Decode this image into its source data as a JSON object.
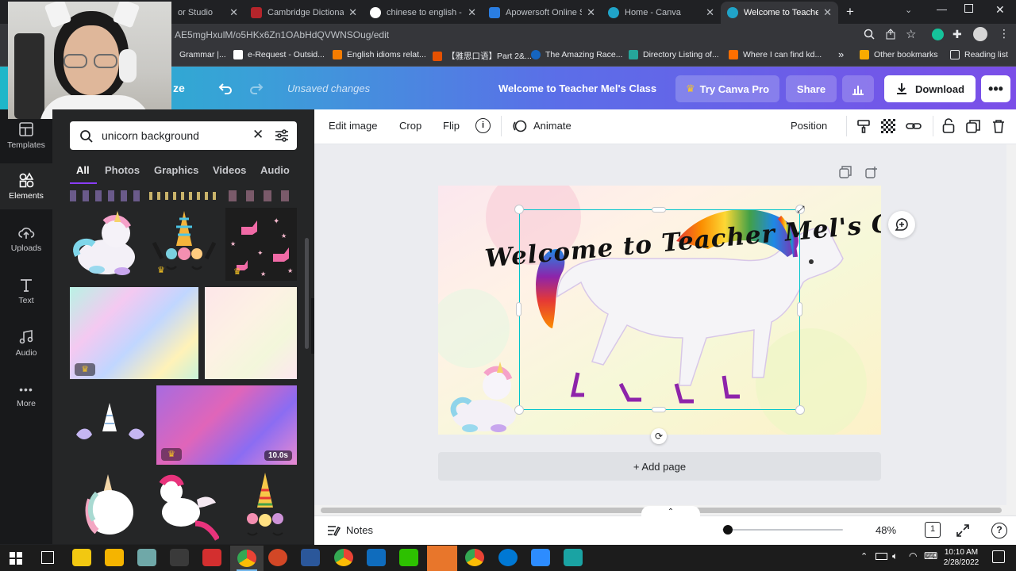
{
  "browser": {
    "tabs": [
      {
        "title": "or Studio"
      },
      {
        "title": "Cambridge Dictionary"
      },
      {
        "title": "chinese to english - G"
      },
      {
        "title": "Apowersoft Online Sc"
      },
      {
        "title": "Home - Canva"
      },
      {
        "title": "Welcome to Teacher M"
      }
    ],
    "url": "AE5mgHxulM/o5HKx6Zn1OAbHdQVWNSOug/edit",
    "bookmarks": [
      {
        "label": "Grammar |..."
      },
      {
        "label": "e-Request - Outsid..."
      },
      {
        "label": "English idioms relat..."
      },
      {
        "label": "【雅思口语】Part 2&..."
      },
      {
        "label": "The Amazing Race..."
      },
      {
        "label": "Directory Listing of..."
      },
      {
        "label": "Where I can find kd..."
      },
      {
        "label": "»"
      },
      {
        "label": "Other bookmarks"
      },
      {
        "label": "Reading list"
      }
    ]
  },
  "header": {
    "resize_label": "ze",
    "status": "Unsaved changes",
    "title": "Welcome to Teacher Mel's Class",
    "try_pro": "Try Canva Pro",
    "share": "Share",
    "download": "Download"
  },
  "sidebar": {
    "items": [
      {
        "label": "Templates"
      },
      {
        "label": "Elements"
      },
      {
        "label": "Uploads"
      },
      {
        "label": "Text"
      },
      {
        "label": "Audio"
      },
      {
        "label": "More"
      }
    ]
  },
  "panel": {
    "search_value": "unicorn background",
    "categories": [
      "All",
      "Photos",
      "Graphics",
      "Videos",
      "Audio"
    ],
    "video_duration": "10.0s"
  },
  "toolbar": {
    "edit_image": "Edit image",
    "crop": "Crop",
    "flip": "Flip",
    "animate": "Animate",
    "position": "Position"
  },
  "canvas": {
    "heading": "Welcome to Teacher Mel's Class",
    "add_page": "+ Add page"
  },
  "footer": {
    "notes": "Notes",
    "zoom": "48%",
    "zoom_fraction": 0.48,
    "page_number": "1"
  },
  "taskbar": {
    "time": "10:10 AM",
    "date": "2/28/2022"
  },
  "colors": {
    "brand_gradient_start": "#1fb7c9",
    "brand_gradient_end": "#7b4ee8",
    "selection": "#00c4cc"
  }
}
